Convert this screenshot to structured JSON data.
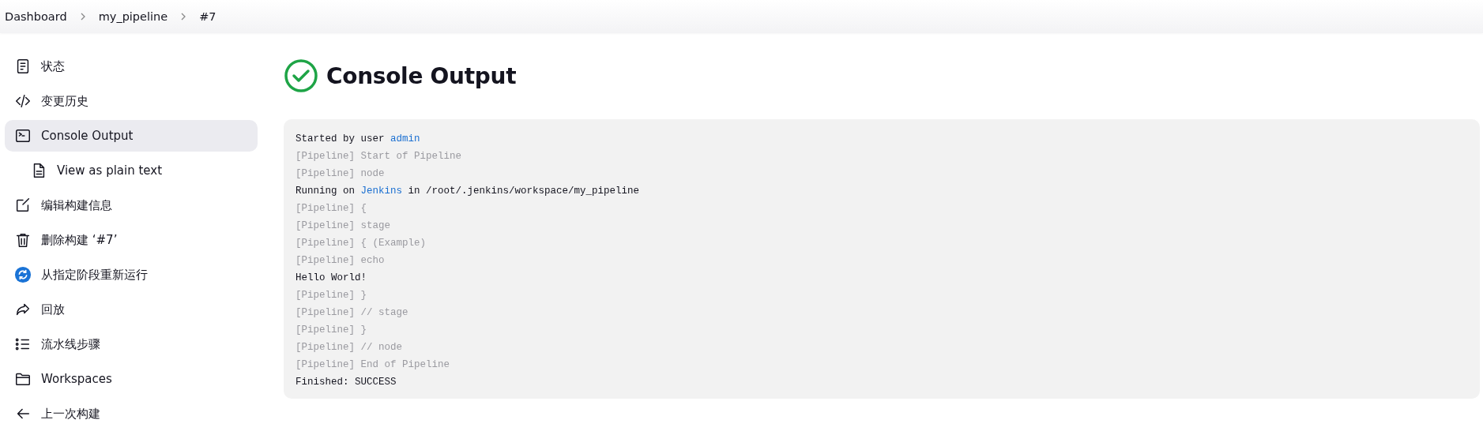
{
  "breadcrumb": [
    {
      "label": "Dashboard"
    },
    {
      "label": "my_pipeline"
    },
    {
      "label": "#7"
    }
  ],
  "sidebar": {
    "items": [
      {
        "label": "状态",
        "selected": false
      },
      {
        "label": "变更历史",
        "selected": false
      },
      {
        "label": "Console Output",
        "selected": true,
        "children": [
          {
            "label": "View as plain text",
            "selected": false
          }
        ]
      },
      {
        "label": "编辑构建信息",
        "selected": false
      },
      {
        "label": "删除构建 ‘#7’",
        "selected": false
      },
      {
        "label": "从指定阶段重新运行",
        "selected": false
      },
      {
        "label": "回放",
        "selected": false
      },
      {
        "label": "流水线步骤",
        "selected": false
      },
      {
        "label": "Workspaces",
        "selected": false
      },
      {
        "label": "上一次构建",
        "selected": false
      }
    ]
  },
  "page": {
    "title": "Console Output",
    "succeeded": true
  },
  "console": {
    "lines": [
      {
        "kind": "output",
        "parts": [
          {
            "kind": "text",
            "text": "Started by user "
          },
          {
            "kind": "link",
            "text": "admin"
          }
        ]
      },
      {
        "kind": "pipeline",
        "parts": [
          {
            "kind": "text",
            "text": "[Pipeline] Start of Pipeline"
          }
        ]
      },
      {
        "kind": "pipeline",
        "parts": [
          {
            "kind": "text",
            "text": "[Pipeline] node"
          }
        ]
      },
      {
        "kind": "output",
        "parts": [
          {
            "kind": "text",
            "text": "Running on "
          },
          {
            "kind": "link",
            "text": "Jenkins"
          },
          {
            "kind": "text",
            "text": " in /root/.jenkins/workspace/my_pipeline"
          }
        ]
      },
      {
        "kind": "pipeline",
        "parts": [
          {
            "kind": "text",
            "text": "[Pipeline] {"
          }
        ]
      },
      {
        "kind": "pipeline",
        "parts": [
          {
            "kind": "text",
            "text": "[Pipeline] stage"
          }
        ]
      },
      {
        "kind": "pipeline",
        "parts": [
          {
            "kind": "text",
            "text": "[Pipeline] { (Example)"
          }
        ]
      },
      {
        "kind": "pipeline",
        "parts": [
          {
            "kind": "text",
            "text": "[Pipeline] echo"
          }
        ]
      },
      {
        "kind": "output",
        "parts": [
          {
            "kind": "text",
            "text": "Hello World!"
          }
        ]
      },
      {
        "kind": "pipeline",
        "parts": [
          {
            "kind": "text",
            "text": "[Pipeline] }"
          }
        ]
      },
      {
        "kind": "pipeline",
        "parts": [
          {
            "kind": "text",
            "text": "[Pipeline] // stage"
          }
        ]
      },
      {
        "kind": "pipeline",
        "parts": [
          {
            "kind": "text",
            "text": "[Pipeline] }"
          }
        ]
      },
      {
        "kind": "pipeline",
        "parts": [
          {
            "kind": "text",
            "text": "[Pipeline] // node"
          }
        ]
      },
      {
        "kind": "pipeline",
        "parts": [
          {
            "kind": "text",
            "text": "[Pipeline] End of Pipeline"
          }
        ]
      },
      {
        "kind": "output",
        "parts": [
          {
            "kind": "text",
            "text": "Finished: SUCCESS"
          }
        ]
      }
    ]
  }
}
